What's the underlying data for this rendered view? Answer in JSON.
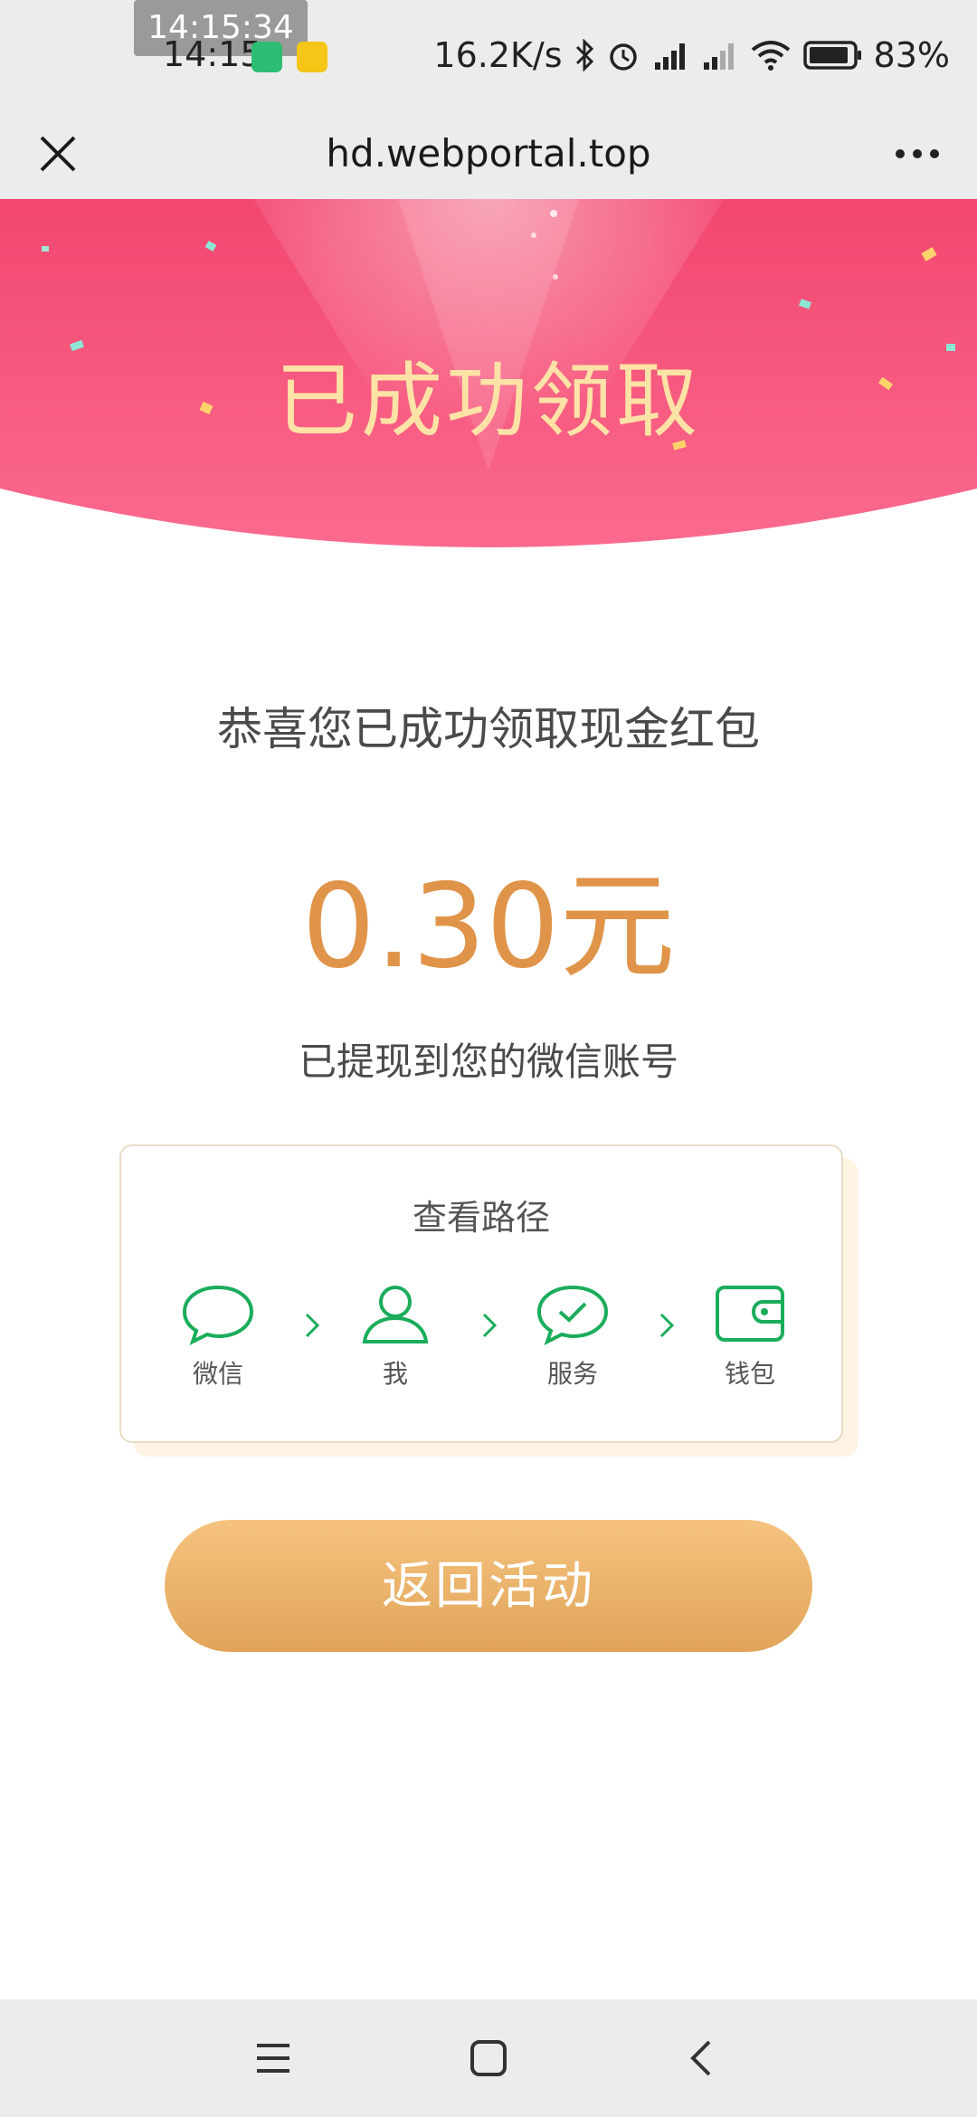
{
  "status_bar": {
    "screenshot_time": "14:15:34",
    "time": "14:15",
    "network_speed": "16.2K/s",
    "battery": "83%"
  },
  "browser": {
    "url": "hd.webportal.top"
  },
  "hero": {
    "title": "已成功领取"
  },
  "content": {
    "congrats": "恭喜您已成功领取现金红包",
    "amount": "0.30元",
    "withdrawn_note": "已提现到您的微信账号"
  },
  "path_card": {
    "title": "查看路径",
    "steps": [
      {
        "label": "微信",
        "icon": "chat-bubble-icon"
      },
      {
        "label": "我",
        "icon": "user-icon"
      },
      {
        "label": "服务",
        "icon": "check-bubble-icon"
      },
      {
        "label": "钱包",
        "icon": "wallet-icon"
      }
    ]
  },
  "actions": {
    "return_label": "返回活动"
  },
  "colors": {
    "hero_pink": "#f0507a",
    "amount_orange": "#e0944a",
    "wechat_green": "#1aad5b",
    "button_gold": "#e9b06a"
  }
}
